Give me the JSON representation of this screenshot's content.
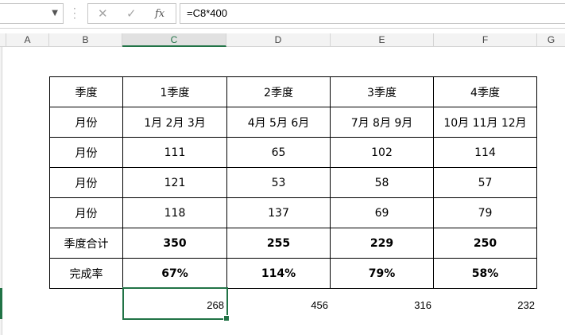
{
  "formula_bar": {
    "fx_label": "fx",
    "cancel_icon": "✕",
    "enter_icon": "✓",
    "formula": "=C8*400"
  },
  "columns": [
    "A",
    "B",
    "C",
    "D",
    "E",
    "F",
    "G"
  ],
  "selected_column": "C",
  "table": {
    "rows": [
      [
        "季度",
        "1季度",
        "2季度",
        "3季度",
        "4季度"
      ],
      [
        "月份",
        "1月 2月 3月",
        "4月 5月 6月",
        "7月 8月 9月",
        "10月 11月 12月"
      ],
      [
        "月份",
        "111",
        "65",
        "102",
        "114"
      ],
      [
        "月份",
        "121",
        "53",
        "58",
        "57"
      ],
      [
        "月份",
        "118",
        "137",
        "69",
        "79"
      ],
      [
        "季度合计",
        "350",
        "255",
        "229",
        "250"
      ],
      [
        "完成率",
        "67%",
        "114%",
        "79%",
        "58%"
      ]
    ]
  },
  "results": [
    "268",
    "456",
    "316",
    "232"
  ],
  "accent_color": "#217346"
}
